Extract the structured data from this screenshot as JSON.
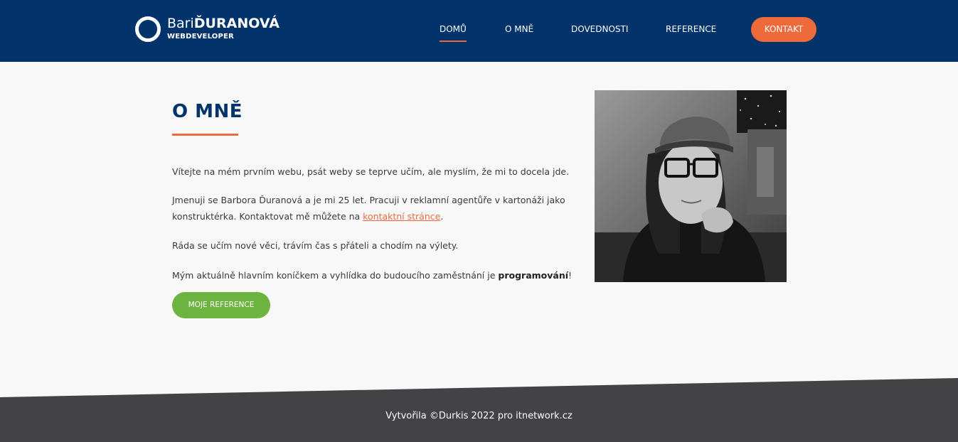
{
  "brand": {
    "name_light": "Bari",
    "name_bold": "ĎURANOVÁ",
    "subtitle": "WEBDEVELOPER"
  },
  "nav": {
    "items": [
      {
        "label": "DOMŮ",
        "active": true
      },
      {
        "label": "O MNĚ"
      },
      {
        "label": "DOVEDNOSTI"
      },
      {
        "label": "REFERENCE"
      }
    ],
    "contact_label": "KONTAKT"
  },
  "main": {
    "title": "O MNĚ",
    "p1": "Vítejte na mém prvním webu, psát weby se teprve učím, ale myslím, že mi to docela jde.",
    "p2_a": "Jmenuji se Barbora Ďuranová a je mi 25 let. Pracuji v reklamní agentůře v kartonáži jako konstruktérka. Kontaktovat mě můžete na ",
    "p2_link": "kontaktní stránce",
    "p2_b": ".",
    "p3": "Ráda se učím nové věci, trávím čas s přáteli a chodím na výlety.",
    "p4_a": "Mým aktuálně hlavním koníčkem a vyhlídka do budoucího zaměstnání je ",
    "p4_bold": "programování",
    "p4_b": "!",
    "button_label": "MOJE REFERENCE"
  },
  "footer": {
    "text": "Vytvořila ©Durkis 2022 pro itnetwork.cz"
  },
  "colors": {
    "header_bg": "#02336b",
    "accent": "#ee6a3a",
    "button_green": "#6db33f",
    "footer_bg": "#434345"
  }
}
